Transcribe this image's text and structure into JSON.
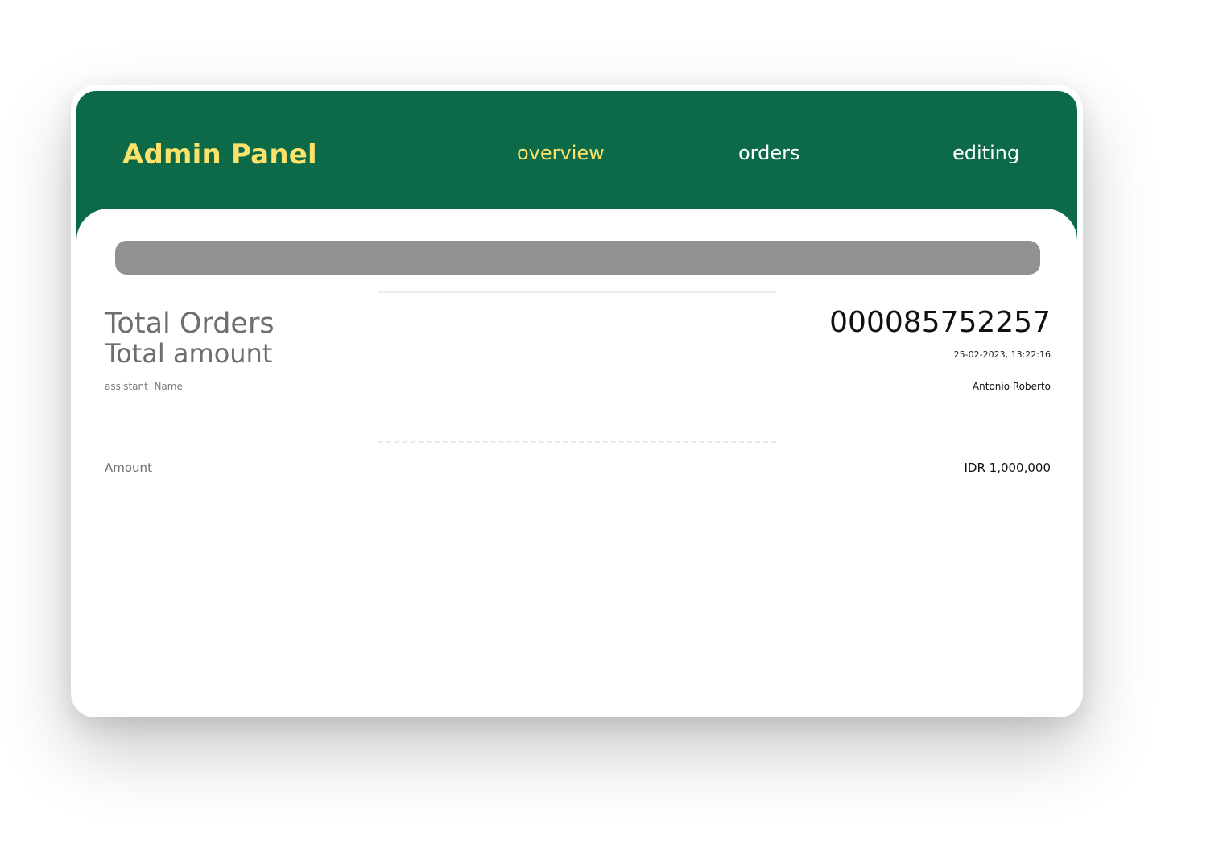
{
  "header": {
    "title": "Admin Panel",
    "nav": [
      {
        "label": "overview",
        "active": true
      },
      {
        "label": "orders",
        "active": false
      },
      {
        "label": "editing",
        "active": false
      }
    ]
  },
  "summary": {
    "total_orders_label": "Total Orders",
    "total_amount_label": "Total amount",
    "assistant_label": "assistant  Name",
    "order_number": "000085752257",
    "datetime": "25-02-2023, 13:22:16",
    "assistant_name": "Antonio Roberto"
  },
  "amount": {
    "label": "Amount",
    "value": "IDR 1,000,000"
  },
  "colors": {
    "header_bg": "#0c6a48",
    "accent": "#fbe26a",
    "search_bar": "#919191"
  }
}
